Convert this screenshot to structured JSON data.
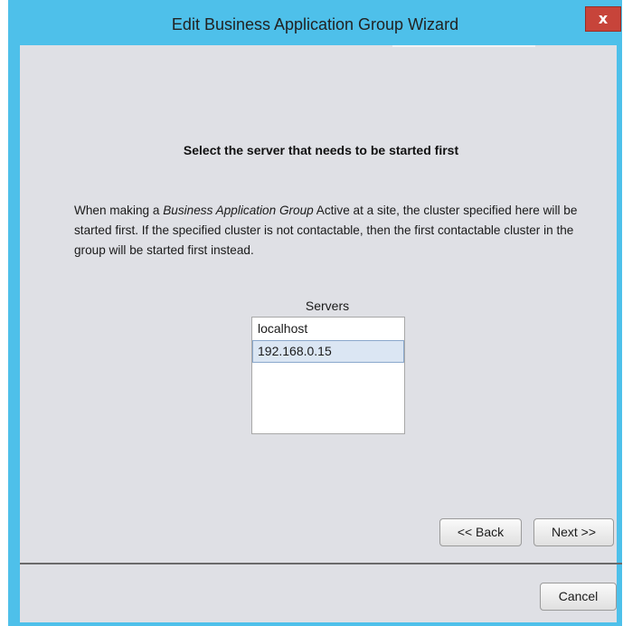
{
  "window": {
    "title": "Edit Business Application Group Wizard",
    "close_icon": "close-icon",
    "close_glyph": "x"
  },
  "main": {
    "heading": "Select the server that needs to be started first",
    "description": {
      "part1": "When making a ",
      "italic": "Business Application Group",
      "part2": " Active at a site, the cluster specified here will be started first. If the specified cluster is not contactable, then the first contactable cluster in the group will be started first instead."
    },
    "servers_label": "Servers",
    "servers": [
      {
        "label": "localhost",
        "selected": false
      },
      {
        "label": "192.168.0.15",
        "selected": true
      }
    ]
  },
  "nav": {
    "back_label": "<< Back",
    "next_label": "Next >>"
  },
  "footer": {
    "cancel_label": "Cancel"
  },
  "colors": {
    "titlebar": "#4ec0ea",
    "content_bg": "#dfe0e5",
    "close_button": "#c7443a",
    "selection": "#dbe6f3"
  }
}
